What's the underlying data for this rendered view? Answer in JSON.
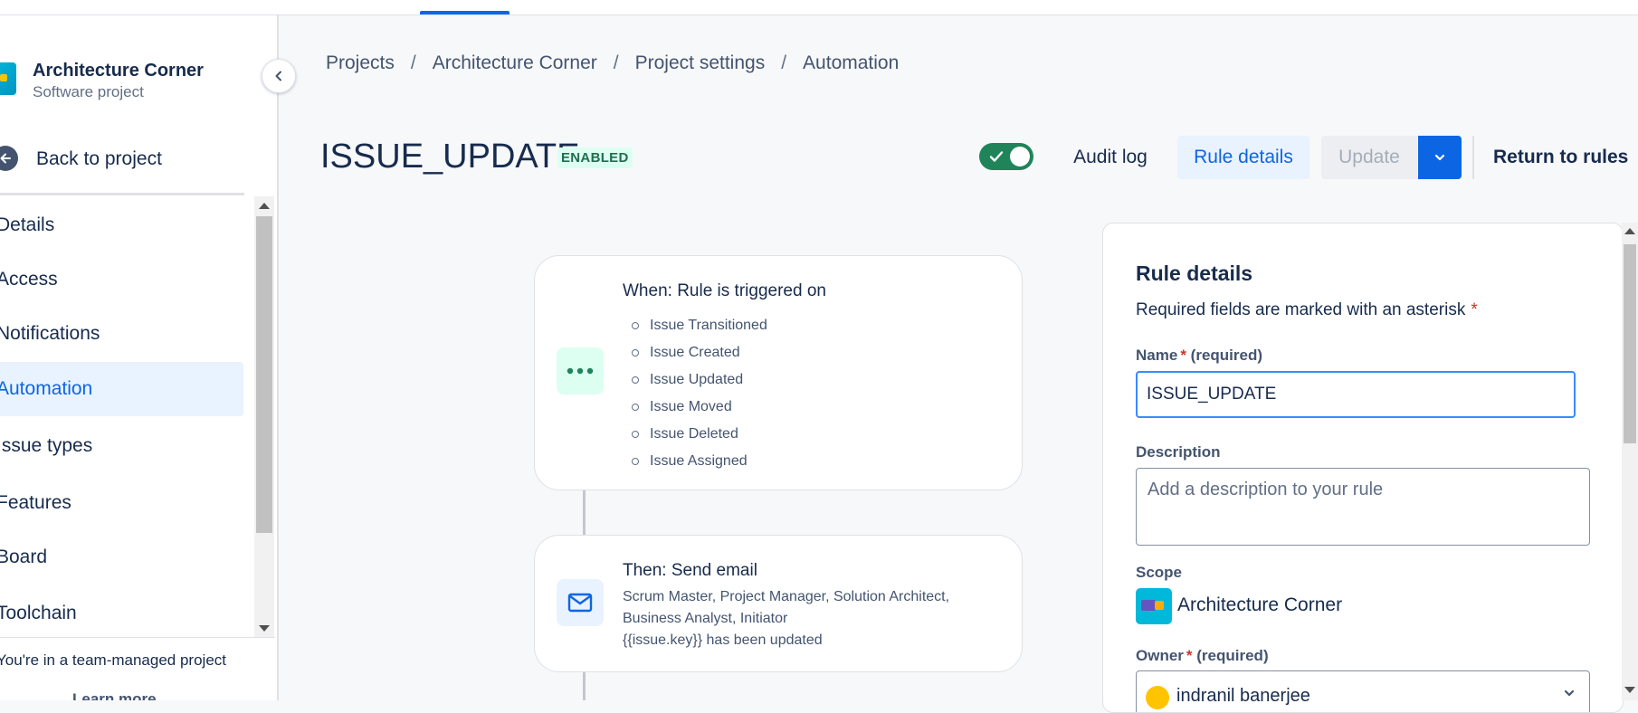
{
  "project": {
    "name": "Architecture Corner",
    "type": "Software project"
  },
  "sidebar": {
    "back_label": "Back to project",
    "items": [
      {
        "label": "Details",
        "selected": false
      },
      {
        "label": "Access",
        "selected": false
      },
      {
        "label": "Notifications",
        "selected": false
      },
      {
        "label": "Automation",
        "selected": true
      },
      {
        "label": "Issue types",
        "selected": false
      },
      {
        "label": "Features",
        "selected": false
      },
      {
        "label": "Board",
        "selected": false
      },
      {
        "label": "Toolchain",
        "selected": false
      }
    ],
    "footer_note": "You're in a team-managed project",
    "learn_more": "Learn more"
  },
  "breadcrumb": [
    "Projects",
    "Architecture Corner",
    "Project settings",
    "Automation"
  ],
  "breadcrumb_separator": "/",
  "header": {
    "rule_name": "ISSUE_UPDATE",
    "status_badge": "ENABLED",
    "toggle_enabled": true,
    "audit_log": "Audit log",
    "rule_details": "Rule details",
    "update": "Update",
    "return_to_rules": "Return to rules"
  },
  "flow": {
    "trigger": {
      "title": "When: Rule is triggered on",
      "icon": "more-dots-icon",
      "events": [
        "Issue Transitioned",
        "Issue Created",
        "Issue Updated",
        "Issue Moved",
        "Issue Deleted",
        "Issue Assigned"
      ]
    },
    "action": {
      "title": "Then: Send email",
      "icon": "mail-icon",
      "recipients_line1": "Scrum Master, Project Manager, Solution Architect,",
      "recipients_line2": "Business Analyst, Initiator",
      "subject": "{{issue.key}} has been updated"
    }
  },
  "details_panel": {
    "title": "Rule details",
    "required_note": "Required fields are marked with an asterisk",
    "asterisk": "*",
    "name_label": "Name",
    "required_suffix": "(required)",
    "name_value": "ISSUE_UPDATE",
    "description_label": "Description",
    "description_placeholder": "Add a description to your rule",
    "scope_label": "Scope",
    "scope_value": "Architecture Corner",
    "owner_label": "Owner",
    "owner_value": "indranil banerjee"
  },
  "colors": {
    "brand_blue": "#0c66e4",
    "enabled_green": "#1f845a",
    "badge_bg": "#dcfff1",
    "required_red": "#c9372c"
  }
}
